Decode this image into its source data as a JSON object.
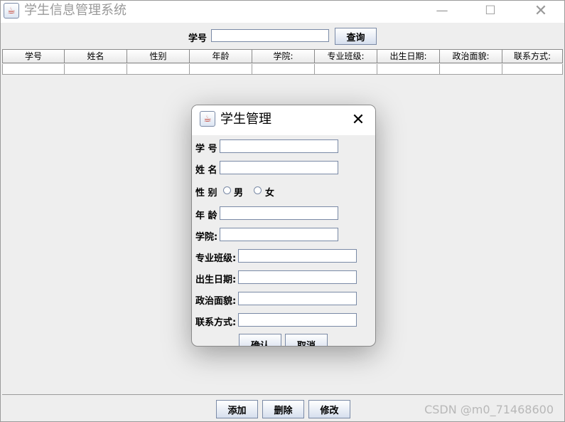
{
  "window": {
    "title": "学生信息管理系统",
    "minimize_icon": "minimize-icon",
    "maximize_icon": "maximize-icon",
    "close_icon": "close-icon"
  },
  "search": {
    "label": "学号",
    "value": "",
    "button": "查询"
  },
  "table": {
    "columns": [
      "学号",
      "姓名",
      "性别",
      "年龄",
      "学院:",
      "专业班级:",
      "出生日期:",
      "政治面貌:",
      "联系方式:"
    ]
  },
  "dialog": {
    "title": "学生管理",
    "fields": {
      "student_id": "学 号",
      "name": "姓 名",
      "gender": "性 别",
      "age": "年 龄",
      "college": "学院:",
      "major_class": "专业班级:",
      "birthdate": "出生日期:",
      "political_status": "政治面貌:",
      "contact": "联系方式:"
    },
    "gender_options": [
      "男",
      "女"
    ],
    "confirm_button": "确认",
    "cancel_button": "取消"
  },
  "toolbar": {
    "add": "添加",
    "delete": "删除",
    "modify": "修改"
  },
  "watermark": "CSDN @m0_71468600",
  "colors": {
    "accent": "#7a8aa6",
    "background": "#eeeeee"
  }
}
